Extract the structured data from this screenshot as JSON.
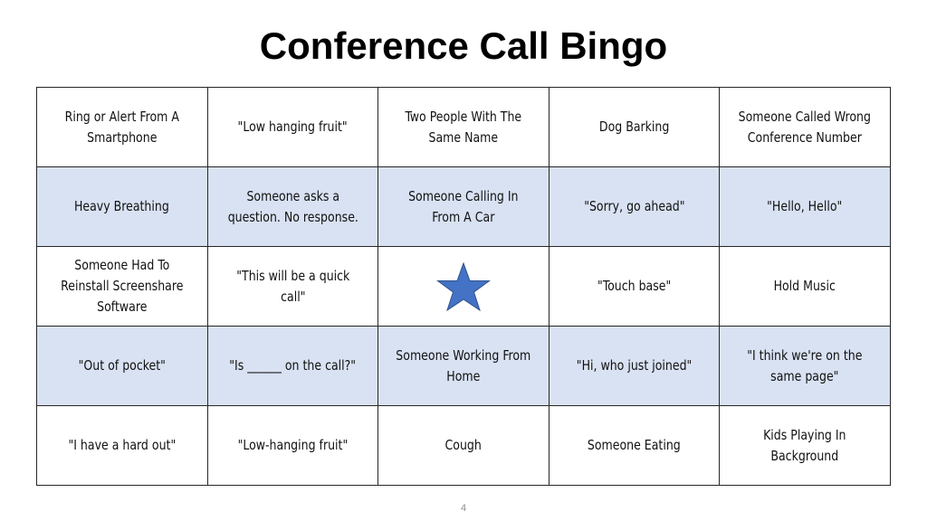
{
  "slide": {
    "title": "Conference Call Bingo",
    "page_number": "4",
    "colors": {
      "shaded_row": "#d9e2f3",
      "star_fill": "#4472c4",
      "star_stroke": "#2f528f"
    }
  },
  "board": {
    "rows": [
      {
        "shaded": false,
        "cells": [
          "Ring or Alert From A Smartphone",
          "\"Low hanging fruit\"",
          "Two People With The Same Name",
          "Dog Barking",
          "Someone Called Wrong Conference Number"
        ]
      },
      {
        "shaded": true,
        "cells": [
          "Heavy Breathing",
          "Someone asks a question. No response.",
          "Someone Calling In From A Car",
          "\"Sorry, go ahead\"",
          "\"Hello, Hello\""
        ]
      },
      {
        "shaded": false,
        "cells": [
          "Someone Had To Reinstall Screenshare Software",
          "\"This will be a quick call\"",
          "",
          "\"Touch base\"",
          "Hold Music"
        ]
      },
      {
        "shaded": true,
        "cells": [
          "\"Out of pocket\"",
          "\"Is ______ on the call?\"",
          "Someone Working From Home",
          "\"Hi, who just joined\"",
          "\"I think we're on the same page\""
        ]
      },
      {
        "shaded": false,
        "cells": [
          "\"I have a hard out\"",
          "\"Low-hanging fruit\"",
          "Cough",
          "Someone Eating",
          "Kids Playing In Background"
        ]
      }
    ],
    "free_space": {
      "row": 2,
      "col": 2,
      "icon": "star-icon"
    }
  }
}
